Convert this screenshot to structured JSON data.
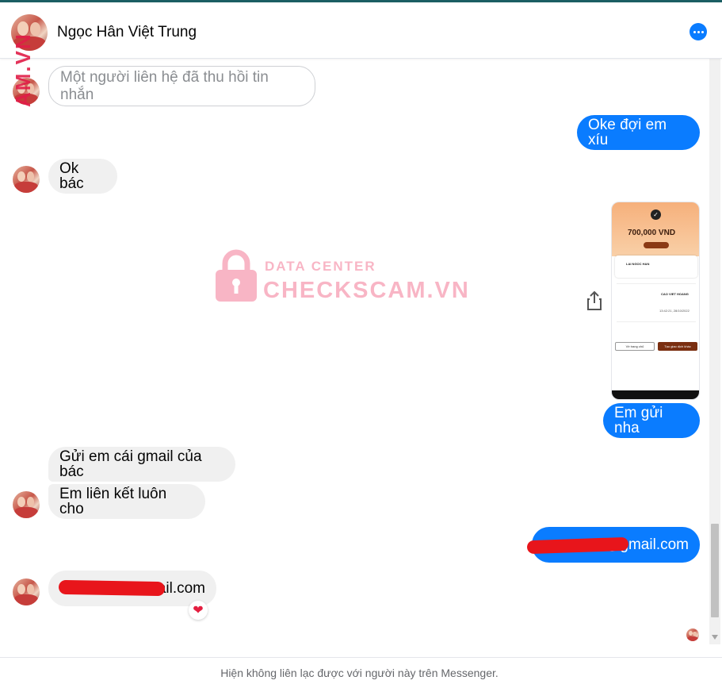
{
  "header": {
    "contact_name": "Ngọc Hân Việt Trung",
    "more_icon": "more-dots-icon"
  },
  "side_watermark": "AM.VN",
  "center_watermark": {
    "line1": "DATA CENTER",
    "line2": "CHECKSCAM.VN"
  },
  "messages": [
    {
      "side": "in",
      "type": "recalled",
      "text": "Một người liên hệ đã thu hồi tin nhắn"
    },
    {
      "side": "out",
      "type": "text",
      "text": "Oke đợi em xíu"
    },
    {
      "side": "in",
      "type": "text",
      "text": "Ok bác"
    },
    {
      "side": "out",
      "type": "image",
      "text": ""
    },
    {
      "side": "out",
      "type": "text",
      "text": "Em gửi nha"
    },
    {
      "side": "in",
      "type": "text",
      "text": "Gửi em cái gmail của bác"
    },
    {
      "side": "in",
      "type": "text",
      "text": "Em liên kết luôn cho"
    },
    {
      "side": "out",
      "type": "text",
      "text": "@gmail.com"
    },
    {
      "side": "in",
      "type": "text",
      "text": "ail.com",
      "reaction": "❤"
    }
  ],
  "receipt": {
    "amount": "700,000 VND",
    "receiver": "LAI NGOC HAN",
    "sender": "CAO VIET HOANG",
    "date": "13:42:21, 28/10/2022",
    "button_left": "Về trang chủ",
    "button_right": "Tạo giao dịch khác"
  },
  "footer": {
    "notice": "Hiện không liên lạc được với người này trên Messenger."
  },
  "colors": {
    "accent": "#0a7cff",
    "incoming_bubble": "#f0f0f0",
    "redaction": "#e8151b",
    "heart": "#e41e3f"
  }
}
